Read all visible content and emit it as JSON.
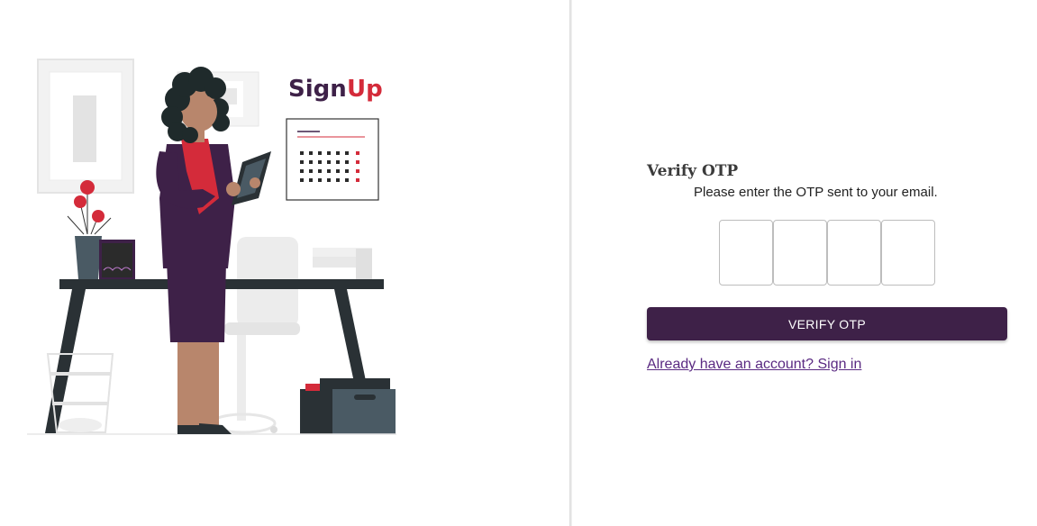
{
  "illustration": {
    "title_part1": "Sign",
    "title_part2": "Up",
    "title_color1": "#3e2148",
    "title_color2": "#d42b3a"
  },
  "form": {
    "heading": "Verify OTP",
    "instruction": "Please enter the OTP sent to your email.",
    "otp_digits": [
      "",
      "",
      "",
      ""
    ],
    "verify_label": "VERIFY OTP",
    "signin_link": "Already have an account? Sign in"
  },
  "colors": {
    "primary": "#3e2148",
    "accent_red": "#d42b3a",
    "link": "#5a2a82"
  }
}
